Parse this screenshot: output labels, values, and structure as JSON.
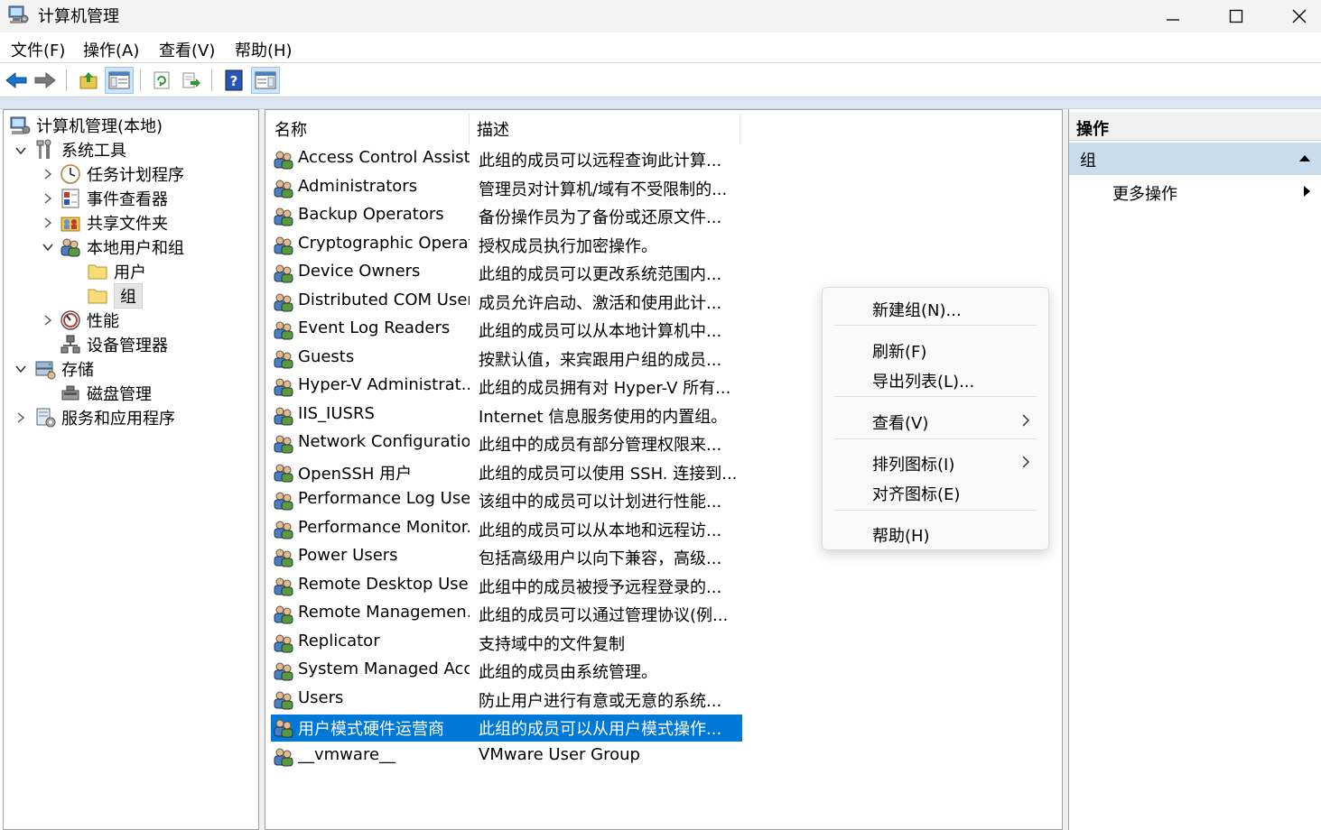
{
  "window": {
    "title": "计算机管理"
  },
  "menu": [
    "文件(F)",
    "操作(A)",
    "查看(V)",
    "帮助(H)"
  ],
  "tree": {
    "root": "计算机管理(本地)",
    "system_tools": "系统工具",
    "task_scheduler": "任务计划程序",
    "event_viewer": "事件查看器",
    "shared_folders": "共享文件夹",
    "local_users_groups": "本地用户和组",
    "users": "用户",
    "groups": "组",
    "performance": "性能",
    "device_manager": "设备管理器",
    "storage": "存储",
    "disk_management": "磁盘管理",
    "services_apps": "服务和应用程序"
  },
  "list": {
    "columns": {
      "name": "名称",
      "description": "描述"
    },
    "rows": [
      {
        "name": "Access Control Assist...",
        "description": "此组的成员可以远程查询此计算..."
      },
      {
        "name": "Administrators",
        "description": "管理员对计算机/域有不受限制的..."
      },
      {
        "name": "Backup Operators",
        "description": "备份操作员为了备份或还原文件..."
      },
      {
        "name": "Cryptographic Operat...",
        "description": "授权成员执行加密操作。"
      },
      {
        "name": "Device Owners",
        "description": "此组的成员可以更改系统范围内..."
      },
      {
        "name": "Distributed COM Users",
        "description": "成员允许启动、激活和使用此计..."
      },
      {
        "name": "Event Log Readers",
        "description": "此组的成员可以从本地计算机中..."
      },
      {
        "name": "Guests",
        "description": "按默认值，来宾跟用户组的成员..."
      },
      {
        "name": "Hyper-V Administrat...",
        "description": "此组的成员拥有对 Hyper-V 所有..."
      },
      {
        "name": "IIS_IUSRS",
        "description": "Internet 信息服务使用的内置组。"
      },
      {
        "name": "Network Configuratio...",
        "description": "此组中的成员有部分管理权限来..."
      },
      {
        "name": "OpenSSH 用户",
        "description": "此组的成员可以使用 SSH. 连接到..."
      },
      {
        "name": "Performance Log Users",
        "description": "该组中的成员可以计划进行性能..."
      },
      {
        "name": "Performance Monitor...",
        "description": "此组的成员可以从本地和远程访..."
      },
      {
        "name": "Power Users",
        "description": "包括高级用户以向下兼容，高级..."
      },
      {
        "name": "Remote Desktop Users",
        "description": "此组中的成员被授予远程登录的..."
      },
      {
        "name": "Remote Managemen...",
        "description": "此组的成员可以通过管理协议(例..."
      },
      {
        "name": "Replicator",
        "description": "支持域中的文件复制"
      },
      {
        "name": "System Managed Acc...",
        "description": "此组的成员由系统管理。"
      },
      {
        "name": "Users",
        "description": "防止用户进行有意或无意的系统..."
      },
      {
        "name": "用户模式硬件运营商",
        "description": "此组的成员可以从用户模式操作..."
      },
      {
        "name": "__vmware__",
        "description": "VMware User Group"
      }
    ],
    "selected_index": 20
  },
  "context_menu": {
    "new_group": "新建组(N)...",
    "refresh": "刷新(F)",
    "export_list": "导出列表(L)...",
    "view": "查看(V)",
    "arrange_icons": "排列图标(I)",
    "align_icons": "对齐图标(E)",
    "help": "帮助(H)"
  },
  "actions": {
    "title": "操作",
    "group": "组",
    "more": "更多操作"
  },
  "colors": {
    "accent": "#0078d7",
    "action_group_bg": "#c9dcee",
    "toolbar_pressed": "#cce4f7"
  }
}
